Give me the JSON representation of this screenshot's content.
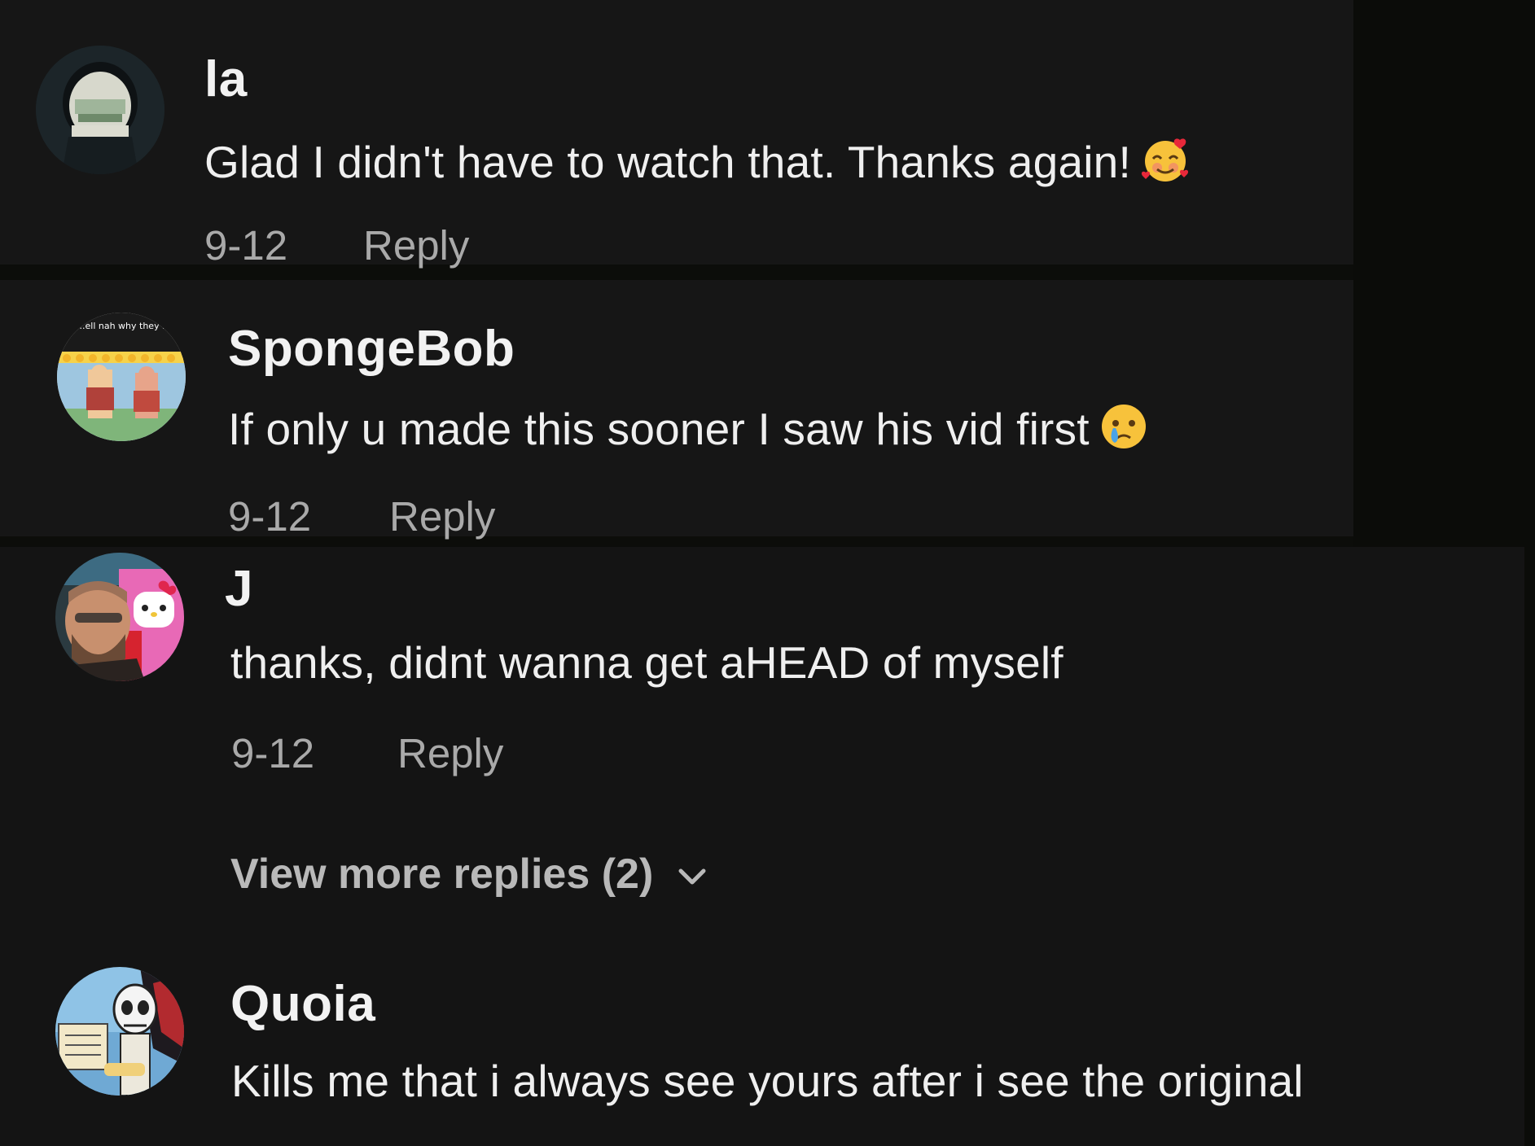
{
  "comments": [
    {
      "username": "la",
      "text": "Glad I didn't have to watch that. Thanks again!",
      "emoji": "smiling-face-with-hearts",
      "date": "9-12",
      "reply_label": "Reply"
    },
    {
      "username": "SpongeBob",
      "text": "If only u made this sooner I saw his vid first",
      "emoji": "face-holding-back-tears",
      "date": "9-12",
      "reply_label": "Reply",
      "avatar_caption": "...ell nah why they ...fts in spongebob"
    },
    {
      "username": "J",
      "text": "thanks, didnt wanna get aHEAD of myself",
      "date": "9-12",
      "reply_label": "Reply",
      "view_more_label": "View more replies (2)"
    },
    {
      "username": "Quoia",
      "text": "Kills me that i always see yours after i see the original"
    }
  ],
  "colors": {
    "background": "#141414",
    "username": "#f2f2f2",
    "body_text": "#efefef",
    "meta_text": "#a9a9a9"
  }
}
